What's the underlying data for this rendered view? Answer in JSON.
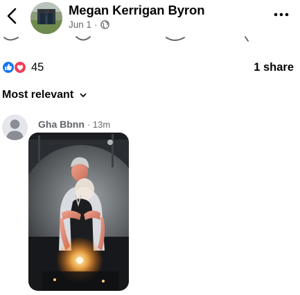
{
  "post": {
    "author_name": "Megan Kerrigan Byron",
    "date": "Jun 1",
    "separator": "·",
    "audience_icon": "globe-icon"
  },
  "header": {
    "back_icon": "chevron-left-icon",
    "more_icon": "more-horizontal-icon"
  },
  "reactions": {
    "icons": [
      "like-icon",
      "love-icon"
    ],
    "count": "45",
    "share_text": "1 share",
    "colors": {
      "like": "#1877f2",
      "love": "#f33e58"
    }
  },
  "comments": {
    "sort_label": "Most relevant",
    "sort_icon": "chevron-down-icon",
    "items": [
      {
        "author": "Gha Bbnn",
        "separator": "·",
        "time": "13m",
        "attachment": "photo"
      }
    ]
  }
}
